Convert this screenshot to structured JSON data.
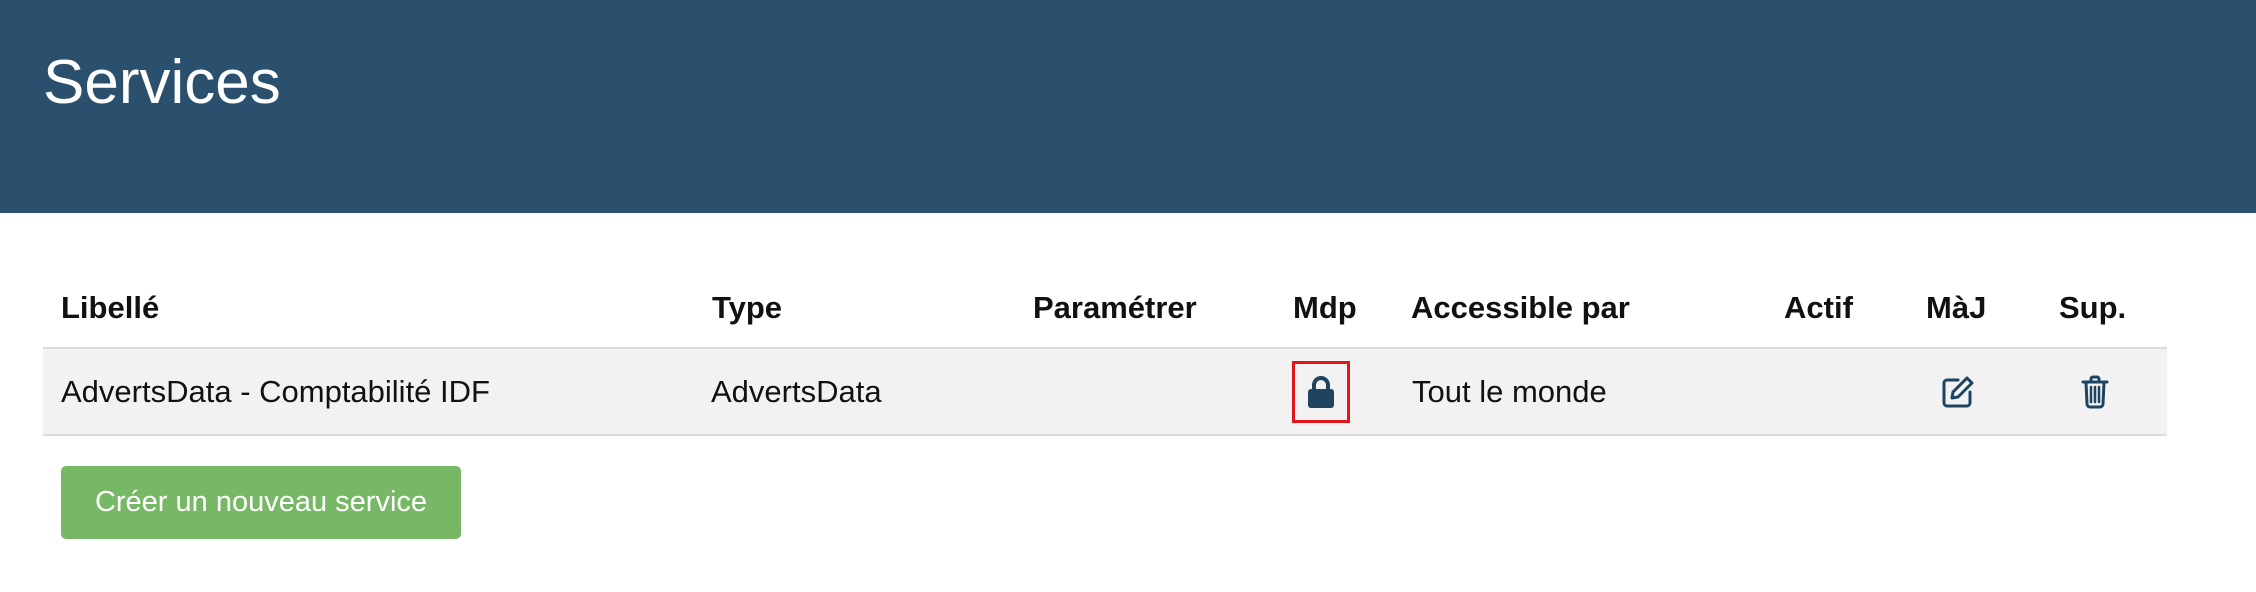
{
  "page": {
    "title": "Services"
  },
  "table": {
    "headers": {
      "libelle": "Libellé",
      "type": "Type",
      "parametrer": "Paramétrer",
      "mdp": "Mdp",
      "accessible": "Accessible par",
      "actif": "Actif",
      "maj": "MàJ",
      "sup": "Sup."
    },
    "rows": [
      {
        "libelle": "AdvertsData - Comptabilité IDF",
        "type": "AdvertsData",
        "parametrer": "",
        "mdp_icon": "lock-icon",
        "accessible": "Tout le monde",
        "actif": "",
        "maj_icon": "edit-icon",
        "sup_icon": "trash-icon"
      }
    ]
  },
  "actions": {
    "create_label": "Créer un nouveau service"
  },
  "colors": {
    "header_bg": "#2a506d",
    "icon": "#1f4461",
    "button_bg": "#77b866",
    "highlight": "#e0161c",
    "row_bg": "#f2f2f2"
  }
}
